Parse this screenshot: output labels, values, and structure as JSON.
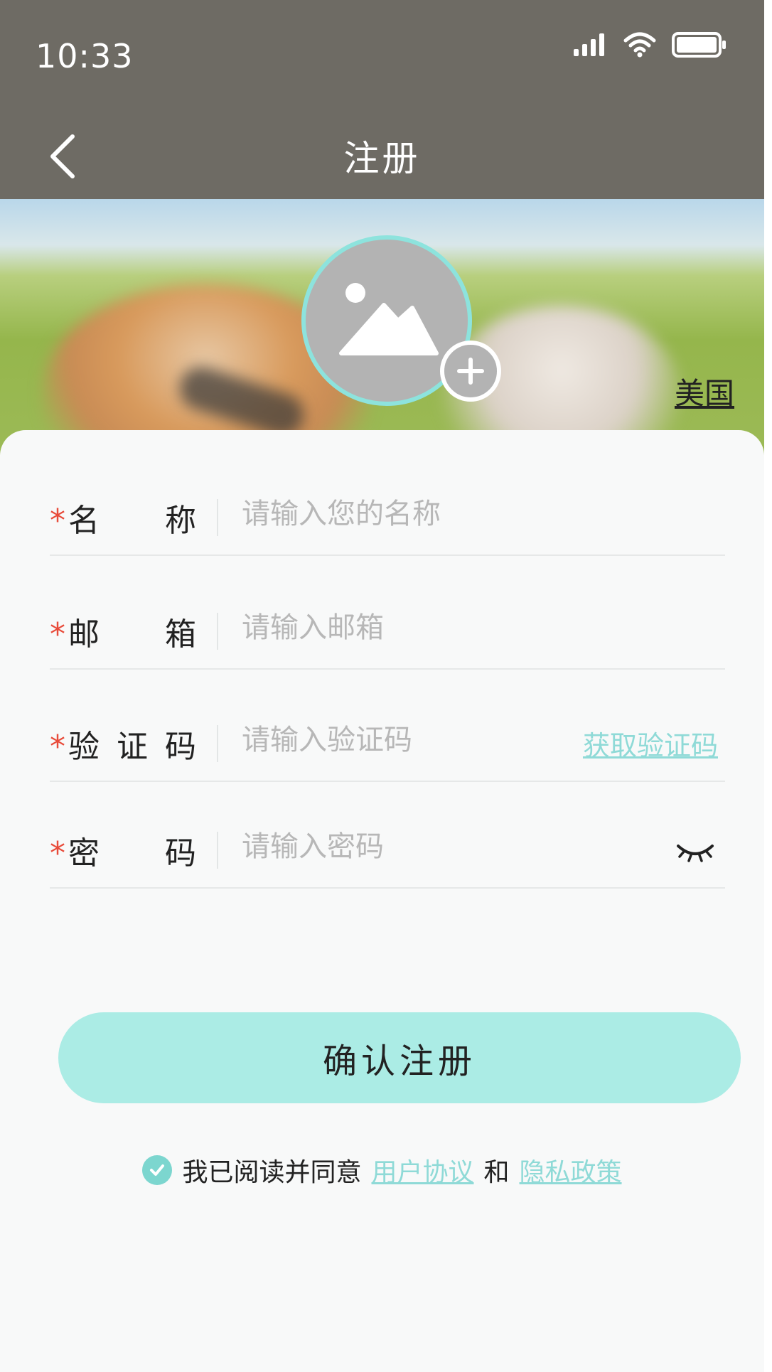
{
  "status_bar": {
    "time": "10:33",
    "icons": [
      "signal-icon",
      "wifi-icon",
      "battery-icon"
    ]
  },
  "nav": {
    "title": "注册",
    "back_icon": "chevron-left-icon"
  },
  "banner": {
    "avatar_icon": "image-placeholder-icon",
    "add_icon": "plus-icon",
    "region": "美国"
  },
  "form": {
    "required_mark": "*",
    "name": {
      "label": "名称",
      "placeholder": "请输入您的名称"
    },
    "email": {
      "label": "邮箱",
      "placeholder": "请输入邮箱"
    },
    "code": {
      "label": "验证码",
      "placeholder": "请输入验证码",
      "action": "获取验证码"
    },
    "password": {
      "label": "密码",
      "placeholder": "请输入密码",
      "toggle_icon": "eye-closed-icon"
    }
  },
  "confirm_label": "确认注册",
  "agreement": {
    "prefix": "我已阅读并同意",
    "terms": "用户协议",
    "and": "和",
    "privacy": "隐私政策",
    "checked": true
  },
  "colors": {
    "header_bg": "#6e6b64",
    "accent": "#abece5",
    "link": "#8fdad7",
    "required": "#e84b3a"
  }
}
